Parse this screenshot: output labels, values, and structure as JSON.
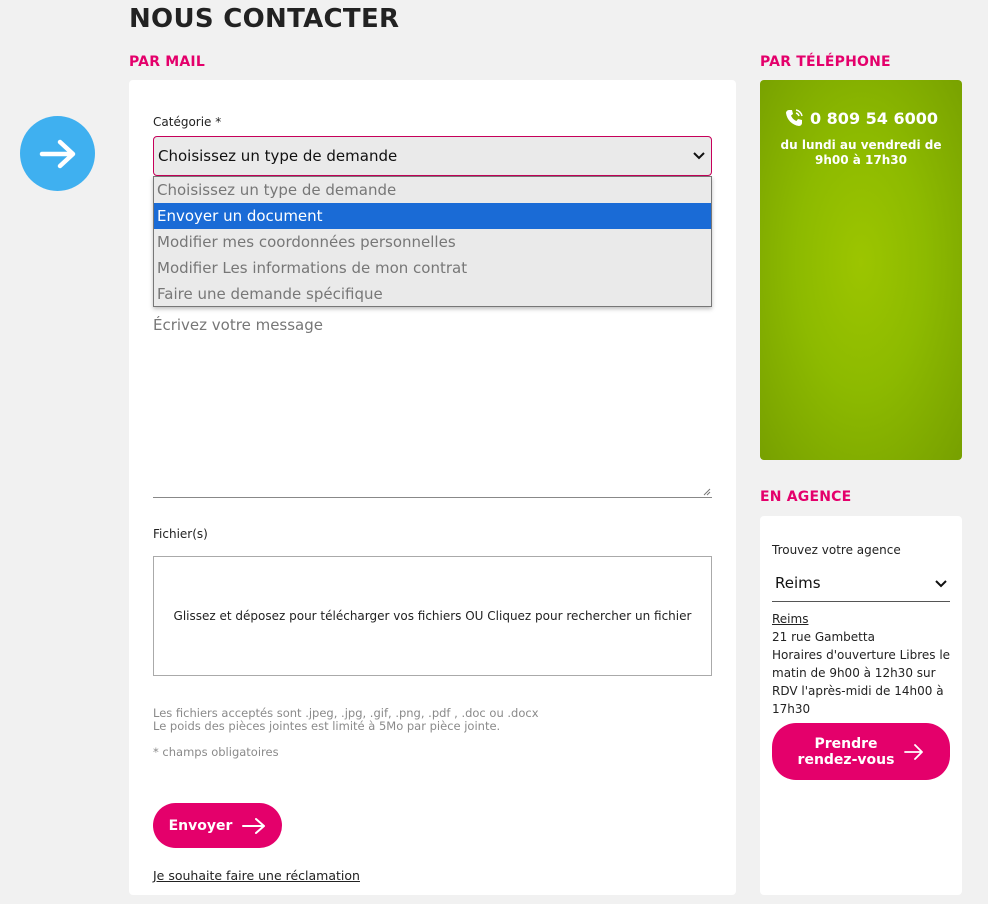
{
  "page_title": "NOUS CONTACTER",
  "sections": {
    "mail": "PAR MAIL",
    "phone": "PAR TÉLÉPHONE",
    "agency": "EN AGENCE"
  },
  "form": {
    "category_label": "Catégorie *",
    "category_selected": "Choisissez un type de demande",
    "category_options": [
      "Choisissez un type de demande",
      "Envoyer un document",
      "Modifier mes coordonnées personnelles",
      "Modifier Les informations de mon contrat",
      "Faire une demande spécifique"
    ],
    "highlighted_option": "Envoyer un document",
    "message_placeholder": "Écrivez votre message",
    "files_label": "Fichier(s)",
    "dropzone_text": "Glissez et déposez pour télécharger vos fichiers OU Cliquez pour rechercher un fichier",
    "accepted_files": "Les fichiers acceptés sont .jpeg, .jpg, .gif, .png, .pdf , .doc ou .docx",
    "size_limit": "Le poids des pièces jointes est limité à 5Mo par pièce jointe.",
    "required_note": "* champs obligatoires",
    "send_label": "Envoyer",
    "complaint_link": "Je souhaite faire une réclamation"
  },
  "phone": {
    "number": "0 809 54 6000",
    "hours_line1": "du lundi au vendredi de",
    "hours_line2": "9h00 à 17h30"
  },
  "agency": {
    "find_label": "Trouvez votre agence",
    "selected_city": "Reims",
    "name": "Reims",
    "address": "21 rue Gambetta",
    "hours": "Horaires d'ouverture Libres le matin de 9h00 à 12h30 sur RDV l'après-midi de 14h00 à 17h30",
    "rdv_line1": "Prendre",
    "rdv_line2": "rendez-vous"
  },
  "colors": {
    "accent": "#e4006b",
    "phone_green": "#8dba00",
    "arrow_blue": "#3fb0f0",
    "highlight_blue": "#1a6bd6"
  },
  "icons": [
    "arrow-right-icon",
    "phone-icon",
    "chevron-down-icon",
    "resize-grip-icon"
  ]
}
